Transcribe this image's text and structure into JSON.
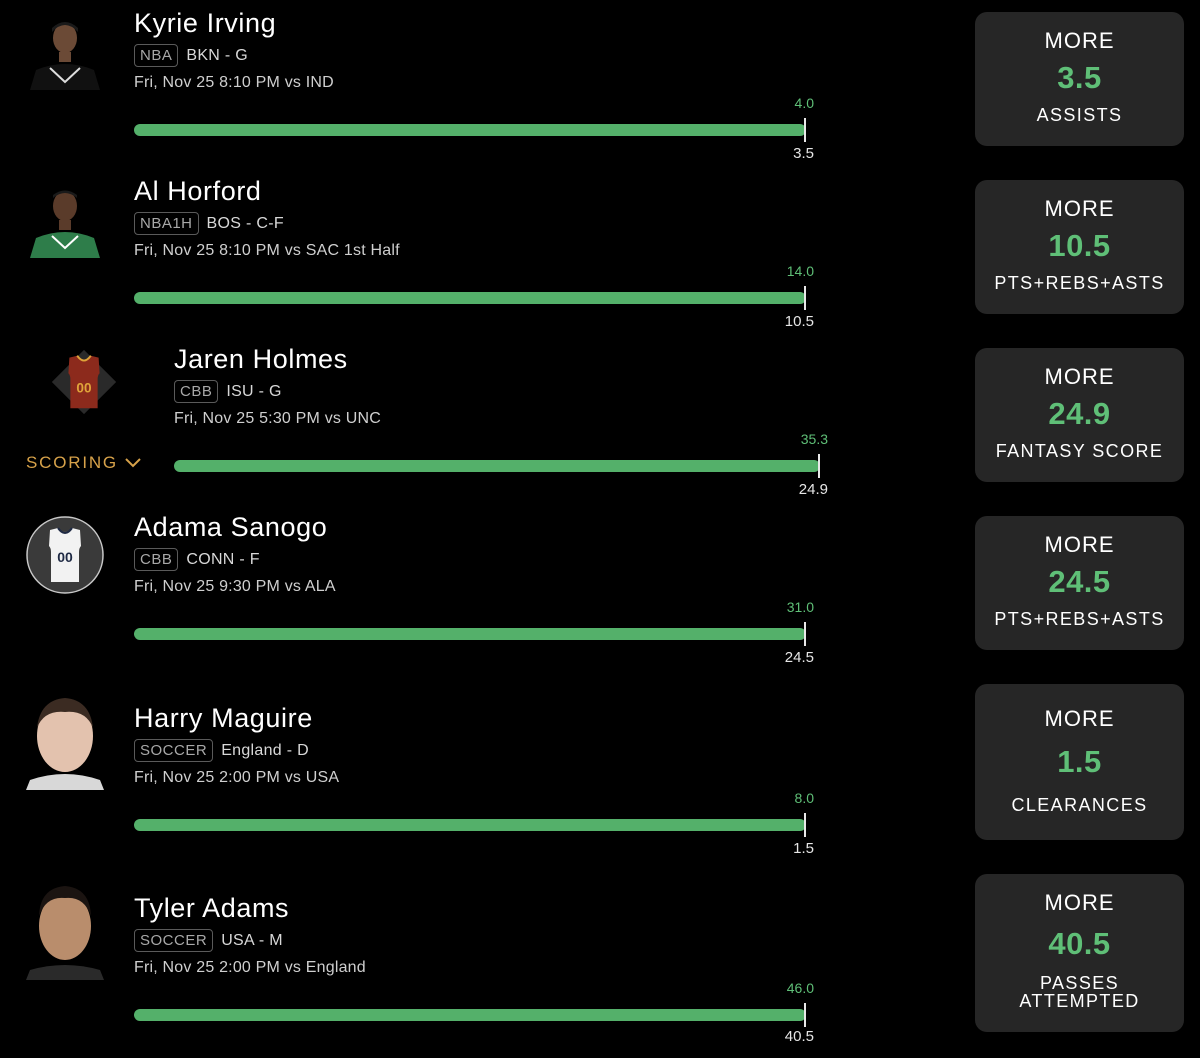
{
  "picks": [
    {
      "name": "Kyrie Irving",
      "league": "NBA",
      "team_pos": "BKN - G",
      "game": "Fri, Nov 25 8:10 PM  vs IND",
      "projection": "4.0",
      "line": "3.5",
      "direction": "MORE",
      "stat": "ASSISTS",
      "avatar": "player-headshot-icon"
    },
    {
      "name": "Al Horford",
      "league": "NBA1H",
      "team_pos": "BOS - C-F",
      "game": "Fri, Nov 25 8:10 PM  vs SAC 1st Half",
      "projection": "14.0",
      "line": "10.5",
      "direction": "MORE",
      "stat": "PTS+REBS+ASTS",
      "avatar": "player-headshot-icon"
    },
    {
      "name": "Jaren Holmes",
      "league": "CBB",
      "team_pos": "ISU - G",
      "game": "Fri, Nov 25 5:30 PM  vs UNC",
      "projection": "35.3",
      "line": "24.9",
      "direction": "MORE",
      "stat": "FANTASY SCORE",
      "avatar": "jersey-icon",
      "scoring_label": "SCORING"
    },
    {
      "name": "Adama Sanogo",
      "league": "CBB",
      "team_pos": "CONN - F",
      "game": "Fri, Nov 25 9:30 PM  vs ALA",
      "projection": "31.0",
      "line": "24.5",
      "direction": "MORE",
      "stat": "PTS+REBS+ASTS",
      "avatar": "jersey-icon"
    },
    {
      "name": "Harry Maguire",
      "league": "SOCCER",
      "team_pos": "England - D",
      "game": "Fri, Nov 25 2:00 PM  vs USA",
      "projection": "8.0",
      "line": "1.5",
      "direction": "MORE",
      "stat": "CLEARANCES",
      "avatar": "player-headshot-icon"
    },
    {
      "name": "Tyler Adams",
      "league": "SOCCER",
      "team_pos": "USA - M",
      "game": "Fri, Nov 25 2:00 PM  vs England",
      "projection": "46.0",
      "line": "40.5",
      "direction": "MORE",
      "stat": "PASSES ATTEMPTED",
      "avatar": "player-headshot-icon"
    }
  ],
  "colors": {
    "accent_green": "#5fbf77",
    "bar_green": "#54b06a",
    "scoring_gold": "#d7a24a",
    "card_bg": "#262626"
  }
}
